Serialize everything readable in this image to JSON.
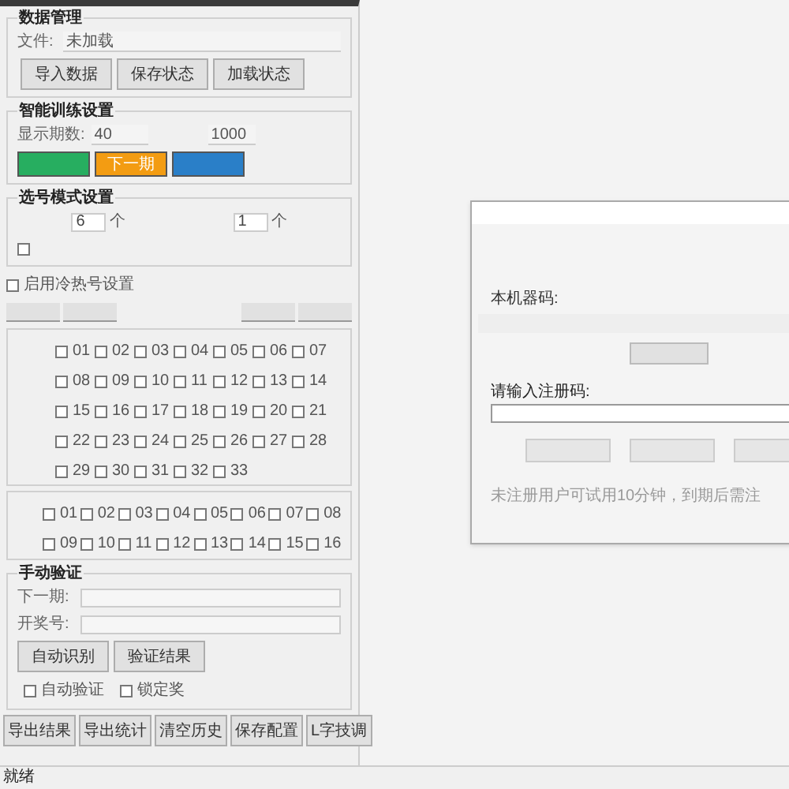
{
  "data_group": {
    "title": "数据管理",
    "file_label": "文件:",
    "file_value": "未加载",
    "buttons": [
      "导入数据",
      "保存状态",
      "加载状态"
    ]
  },
  "training_group": {
    "title": "智能训练设置",
    "period_label": "显示期数:",
    "period_value": "40",
    "limit_value": "1000",
    "action_buttons": [
      {
        "color": "#27ae60"
      },
      {
        "label": "下一期",
        "color": "#f39c12"
      },
      {
        "color": "#2a7fc8"
      }
    ]
  },
  "mode_group": {
    "title": "选号模式设置",
    "spinners": [
      {
        "value": "6",
        "unit": "个"
      },
      {
        "value": "1",
        "unit": "个"
      }
    ],
    "option_checked": false
  },
  "hot_cold": {
    "checkbox": {
      "label": "启用冷热号设置",
      "checked": false
    }
  },
  "numbers_a": [
    {
      "label": "01",
      "checked": false
    },
    {
      "label": "02",
      "checked": false
    },
    {
      "label": "03",
      "checked": false
    },
    {
      "label": "04",
      "checked": false
    },
    {
      "label": "05",
      "checked": false
    },
    {
      "label": "06",
      "checked": false
    },
    {
      "label": "07",
      "checked": false
    },
    {
      "label": "08",
      "checked": false
    },
    {
      "label": "09",
      "checked": false
    },
    {
      "label": "10",
      "checked": false
    },
    {
      "label": "11",
      "checked": false
    },
    {
      "label": "12",
      "checked": false
    },
    {
      "label": "13",
      "checked": false
    },
    {
      "label": "14",
      "checked": false
    },
    {
      "label": "15",
      "checked": false
    },
    {
      "label": "16",
      "checked": false
    },
    {
      "label": "17",
      "checked": false
    },
    {
      "label": "18",
      "checked": false
    },
    {
      "label": "19",
      "checked": false
    },
    {
      "label": "20",
      "checked": false
    },
    {
      "label": "21",
      "checked": false
    },
    {
      "label": "22",
      "checked": false
    },
    {
      "label": "23",
      "checked": false
    },
    {
      "label": "24",
      "checked": false
    },
    {
      "label": "25",
      "checked": false
    },
    {
      "label": "26",
      "checked": false
    },
    {
      "label": "27",
      "checked": false
    },
    {
      "label": "28",
      "checked": false
    },
    {
      "label": "29",
      "checked": false
    },
    {
      "label": "30",
      "checked": false
    },
    {
      "label": "31",
      "checked": false
    },
    {
      "label": "32",
      "checked": false
    },
    {
      "label": "33",
      "checked": false
    }
  ],
  "numbers_b": [
    {
      "label": "01",
      "checked": false
    },
    {
      "label": "02",
      "checked": false
    },
    {
      "label": "03",
      "checked": false
    },
    {
      "label": "04",
      "checked": false
    },
    {
      "label": "05",
      "checked": false
    },
    {
      "label": "06",
      "checked": false
    },
    {
      "label": "07",
      "checked": false
    },
    {
      "label": "08",
      "checked": false
    },
    {
      "label": "09",
      "checked": false
    },
    {
      "label": "10",
      "checked": false
    },
    {
      "label": "11",
      "checked": false
    },
    {
      "label": "12",
      "checked": false
    },
    {
      "label": "13",
      "checked": false
    },
    {
      "label": "14",
      "checked": false
    },
    {
      "label": "15",
      "checked": false
    },
    {
      "label": "16",
      "checked": false
    }
  ],
  "verify_group": {
    "title": "手动验证",
    "fields": [
      "下一期:",
      "开奖号:"
    ],
    "buttons": [
      "自动识别",
      "验证结果"
    ],
    "checkboxes": [
      {
        "label": "自动验证",
        "checked": false
      },
      {
        "label": "锁定奖",
        "checked": false
      }
    ]
  },
  "bottom_buttons": [
    "导出结果",
    "导出统计",
    "清空历史",
    "保存配置",
    "L字技调"
  ],
  "status_bar": "就绪",
  "dialog": {
    "machine_code_label": "本机器码:",
    "register_label": "请输入注册码:",
    "note": "未注册用户可试用10分钟，到期后需注"
  }
}
